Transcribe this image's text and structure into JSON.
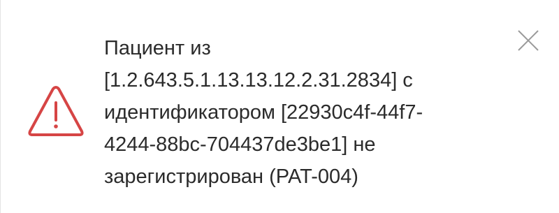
{
  "notification": {
    "type": "warning",
    "icon": "warning-triangle-icon",
    "accent_color": "#d64545",
    "message": "Пациент из\n[1.2.643.5.1.13.13.12.2.31.2834] с\nидентификатором [22930c4f-44f7-\n4244-88bc-704437de3be1] не\nзарегистрирован (PAT-004)",
    "close_icon": "close-icon"
  }
}
